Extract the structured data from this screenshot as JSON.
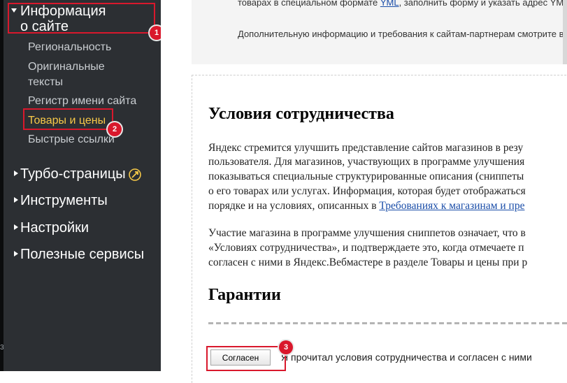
{
  "sidebar": {
    "info_section": {
      "title_line1": "Информация",
      "title_line2": "о сайте",
      "items": [
        "Региональность",
        "Оригинальные",
        "тексты",
        "Регистр имени сайта",
        "Товары и цены",
        "Быстрые ссылки"
      ]
    },
    "sections": [
      "Турбо-страницы",
      "Инструменты",
      "Настройки",
      "Полезные сервисы"
    ],
    "stripe_number": "3",
    "active_color": "#f7c948"
  },
  "annotations": {
    "badge1": "1",
    "badge2": "2",
    "badge3": "3",
    "highlight_color": "#d9182c"
  },
  "main": {
    "top_line1_pre": "товарах в специальном формате ",
    "top_line1_link": "YML",
    "top_line1_post": ", заполнить форму и указать адрес YML-",
    "top_line2_pre": "Дополнительную информацию и требования к сайтам-партнерам смотрите в ",
    "top_line2_link": "Г",
    "heading1": "Условия сотрудничества",
    "para1": [
      "Яндекс стремится улучшить представление сайтов магазинов в резу",
      "пользователя. Для магазинов, участвующих в программе улучшения",
      "показываться специальные структурированные описания (сниппеты",
      "о его товарах или услугах. Информация, которая будет отображаться"
    ],
    "para1_last_pre": "порядке и на условиях, описанных в ",
    "para1_last_link": "Требованиях к магазинам и пре",
    "para2": [
      "Участие магазина в программе улучшения сниппетов означает, что в",
      "«Условиях сотрудничества», и подтверждаете это, когда отмечаете п",
      "согласен с ними в Яндекс.Вебмастере в разделе Товары и цены при р"
    ],
    "heading2": "Гарантии",
    "agree_button": "Согласен",
    "agree_text": "Я прочитал условия сотрудничества и согласен с ними"
  }
}
